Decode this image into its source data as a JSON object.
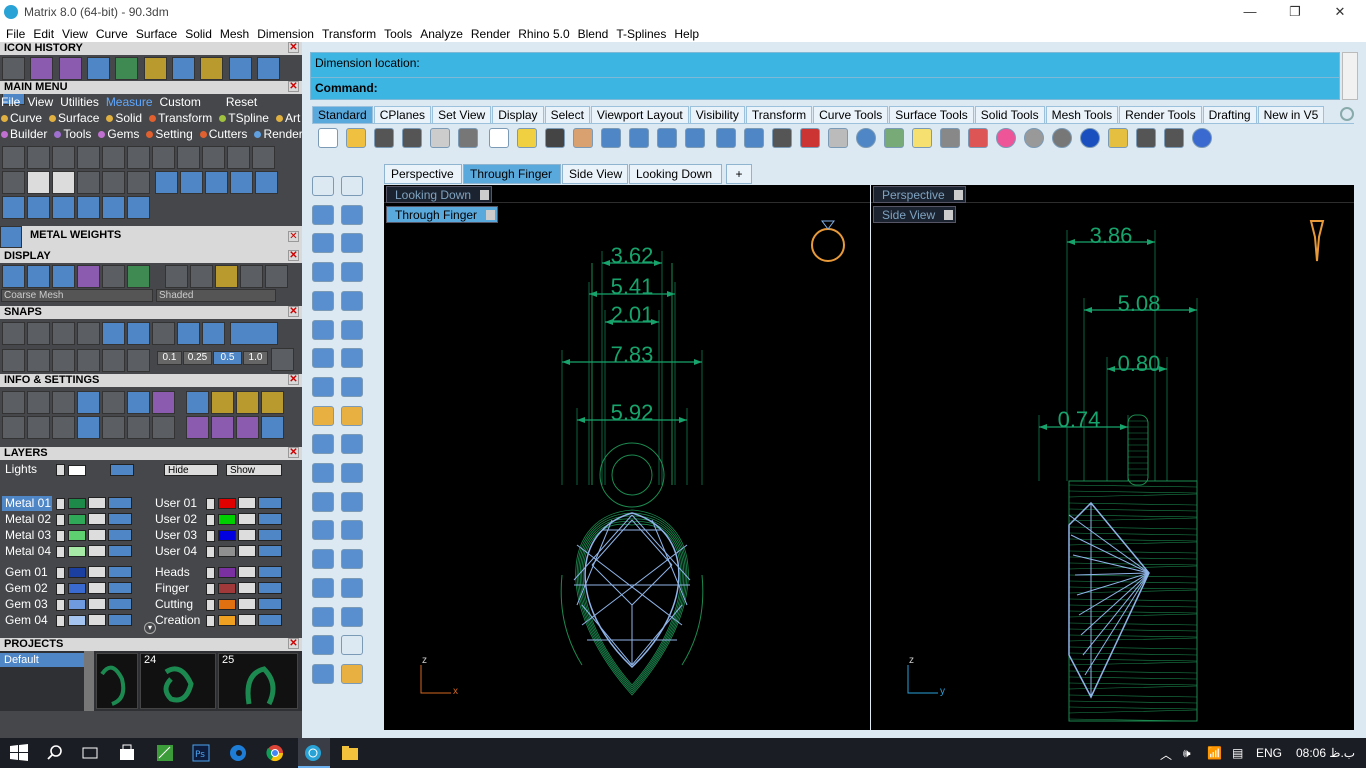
{
  "window": {
    "title": "Matrix 8.0 (64-bit) - 90.3dm",
    "minimize": "—",
    "restore": "❐",
    "close": "✕"
  },
  "menu": [
    "File",
    "Edit",
    "View",
    "Curve",
    "Surface",
    "Solid",
    "Mesh",
    "Dimension",
    "Transform",
    "Tools",
    "Analyze",
    "Render",
    "Rhino 5.0",
    "Blend",
    "T-Splines",
    "Help"
  ],
  "left": {
    "icon_history": "ICON HISTORY",
    "main_menu": "MAIN MENU",
    "main_menu_tabs": [
      "File",
      "View",
      "Utilities",
      "Measure",
      "Custom",
      "Reset"
    ],
    "main_menu_active_tab": "Measure",
    "categories_row1": [
      {
        "label": "Curve",
        "color": "#e0b040"
      },
      {
        "label": "Surface",
        "color": "#e0b040"
      },
      {
        "label": "Solid",
        "color": "#e0b040"
      },
      {
        "label": "Transform",
        "color": "#e06030"
      },
      {
        "label": "TSpline",
        "color": "#a0c040"
      },
      {
        "label": "Art",
        "color": "#e0b040"
      }
    ],
    "categories_row2": [
      {
        "label": "Builder",
        "color": "#c070d0"
      },
      {
        "label": "Tools",
        "color": "#a070d0"
      },
      {
        "label": "Gems",
        "color": "#c070d0"
      },
      {
        "label": "Setting",
        "color": "#e06030"
      },
      {
        "label": "Cutters",
        "color": "#e06030"
      },
      {
        "label": "Render",
        "color": "#60a0e0"
      }
    ],
    "metal_weights": "METAL WEIGHTS",
    "display": "DISPLAY",
    "display_mesh": "Coarse Mesh",
    "display_mode": "Shaded",
    "snaps": "SNAPS",
    "snap_values": [
      "0.1",
      "0.25",
      "0.5",
      "1.0"
    ],
    "info_settings": "INFO & SETTINGS",
    "layers": "LAYERS",
    "layers_lights": "Lights",
    "hide_label": "Hide",
    "show_label": "Show",
    "layers_left": [
      {
        "name": "Metal 01",
        "color": "#1e8a4a",
        "selected": true
      },
      {
        "name": "Metal 02",
        "color": "#2fa858",
        "selected": false
      },
      {
        "name": "Metal 03",
        "color": "#5fd070",
        "selected": false
      },
      {
        "name": "Metal 04",
        "color": "#a6e8a6",
        "selected": false
      },
      {
        "name": "Gem 01",
        "color": "#1a3fa0",
        "selected": false
      },
      {
        "name": "Gem 02",
        "color": "#3a6ad0",
        "selected": false
      },
      {
        "name": "Gem 03",
        "color": "#6f9ae0",
        "selected": false
      },
      {
        "name": "Gem 04",
        "color": "#a6c4f0",
        "selected": false
      }
    ],
    "layers_right": [
      {
        "name": "User 01",
        "color": "#e00000"
      },
      {
        "name": "User 02",
        "color": "#00d000"
      },
      {
        "name": "User 03",
        "color": "#0000e0"
      },
      {
        "name": "User 04",
        "color": "#909090"
      },
      {
        "name": "Heads",
        "color": "#7a30a0"
      },
      {
        "name": "Finger",
        "color": "#a03a3a"
      },
      {
        "name": "Cutting",
        "color": "#e07010"
      },
      {
        "name": "Creation",
        "color": "#f0a020"
      }
    ],
    "projects": "PROJECTS",
    "project_default": "Default",
    "project_numbers": [
      "24",
      "25"
    ]
  },
  "command": {
    "line1": "Dimension location:",
    "line2": "Command:"
  },
  "toolbar_tabs": [
    "Standard",
    "CPlanes",
    "Set View",
    "Display",
    "Select",
    "Viewport Layout",
    "Visibility",
    "Transform",
    "Curve Tools",
    "Surface Tools",
    "Solid Tools",
    "Mesh Tools",
    "Render Tools",
    "Drafting",
    "New in V5"
  ],
  "toolbar_active": "Standard",
  "viewport_tabs": [
    "Perspective",
    "Through Finger",
    "Side View",
    "Looking Down",
    "+"
  ],
  "viewport_active": "Through Finger",
  "viewports": {
    "top_left_label": "Looking Down",
    "top_right_label": "Perspective",
    "left_label": "Through Finger",
    "right_label": "Side View",
    "left_dims": [
      "3.62",
      "5.41",
      "2.01",
      "7.83",
      "5.92"
    ],
    "right_dims": [
      "3.86",
      "5.08",
      "0.80",
      "0.74"
    ],
    "left_axes": {
      "v": "z",
      "h": "x"
    },
    "right_axes": {
      "v": "z",
      "h": "y"
    }
  },
  "taskbar": {
    "lang": "ENG",
    "time": "08:06 ب.ظ"
  }
}
